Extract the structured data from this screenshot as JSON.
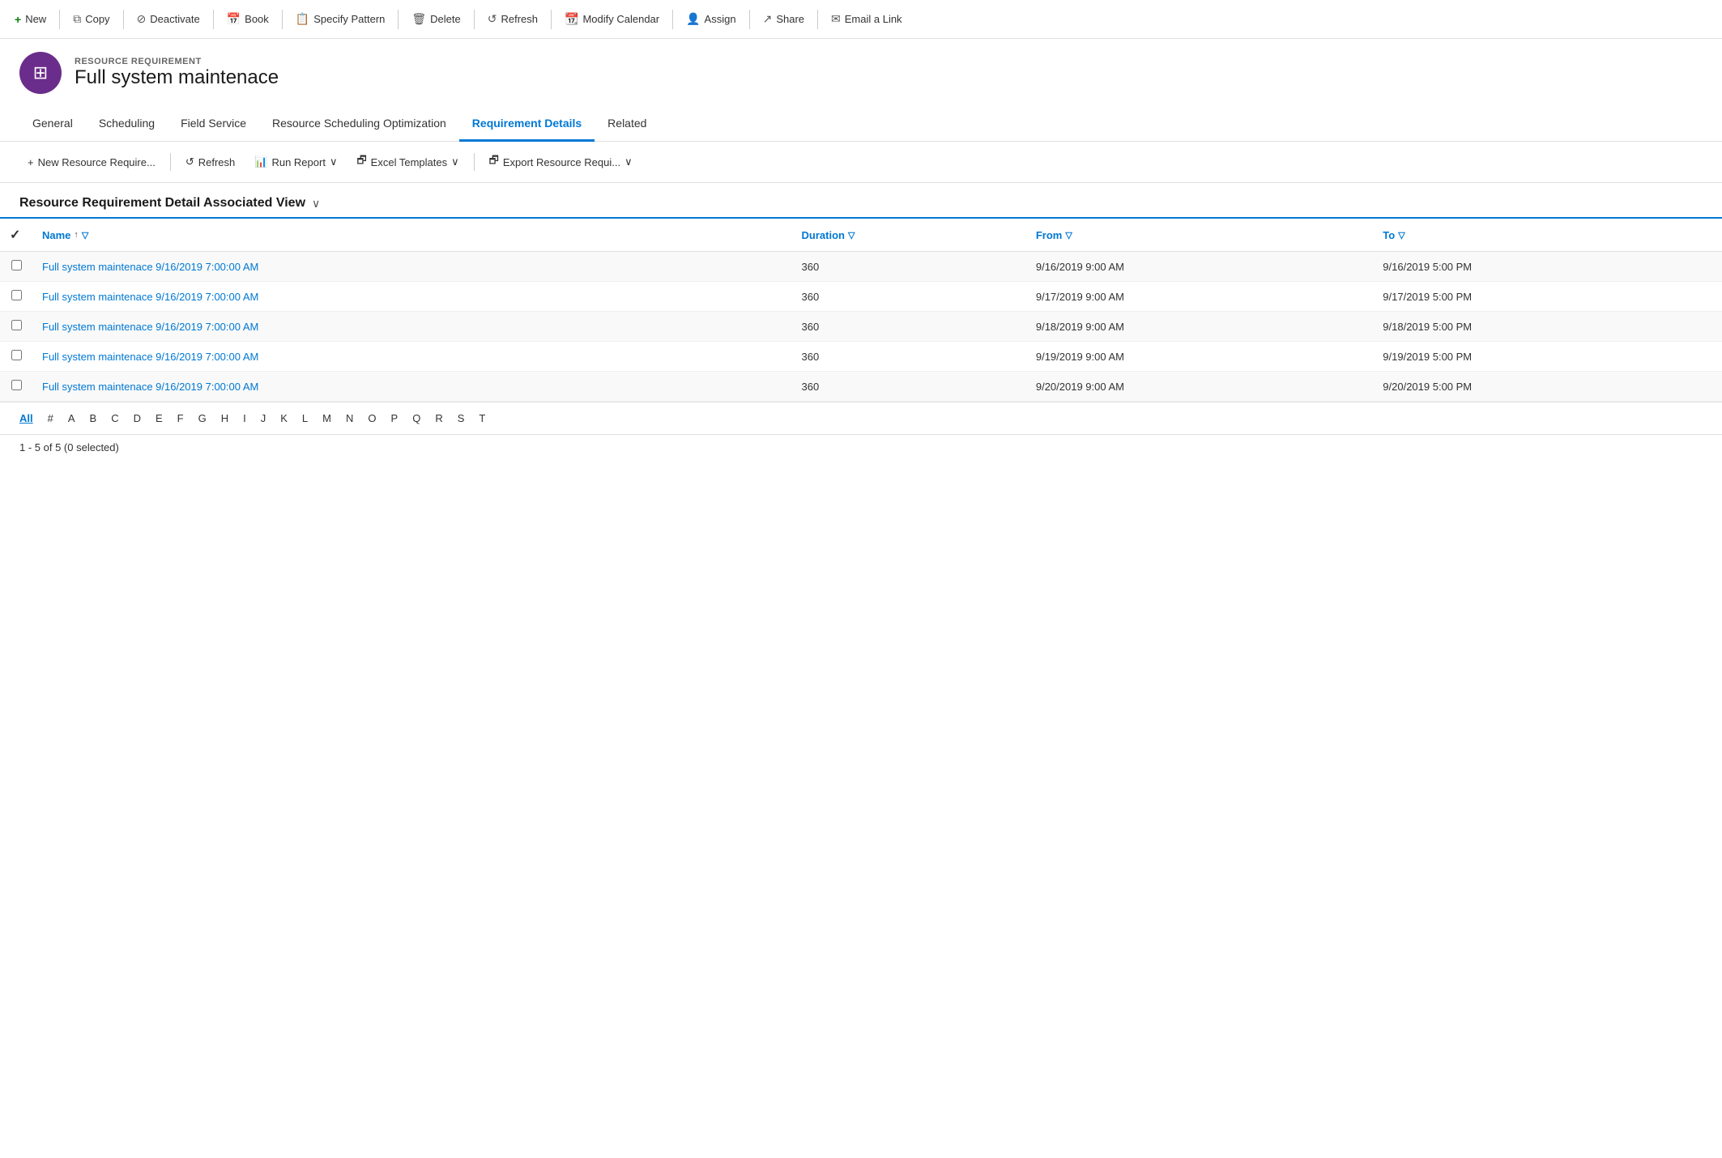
{
  "toolbar": {
    "buttons": [
      {
        "id": "new",
        "icon": "+",
        "label": "New",
        "icon_type": "plus"
      },
      {
        "id": "copy",
        "icon": "⧉",
        "label": "Copy"
      },
      {
        "id": "deactivate",
        "icon": "⊘",
        "label": "Deactivate"
      },
      {
        "id": "book",
        "icon": "📅",
        "label": "Book"
      },
      {
        "id": "specify-pattern",
        "icon": "📋",
        "label": "Specify Pattern"
      },
      {
        "id": "delete",
        "icon": "🗑",
        "label": "Delete"
      },
      {
        "id": "refresh",
        "icon": "↺",
        "label": "Refresh"
      },
      {
        "id": "modify-calendar",
        "icon": "📆",
        "label": "Modify Calendar"
      },
      {
        "id": "assign",
        "icon": "👤",
        "label": "Assign"
      },
      {
        "id": "share",
        "icon": "↗",
        "label": "Share"
      },
      {
        "id": "email-link",
        "icon": "✉",
        "label": "Email a Link"
      }
    ]
  },
  "header": {
    "subtitle": "RESOURCE REQUIREMENT",
    "title": "Full system maintenace",
    "avatar_icon": "⊞"
  },
  "nav": {
    "tabs": [
      {
        "id": "general",
        "label": "General"
      },
      {
        "id": "scheduling",
        "label": "Scheduling"
      },
      {
        "id": "field-service",
        "label": "Field Service"
      },
      {
        "id": "resource-scheduling",
        "label": "Resource Scheduling Optimization"
      },
      {
        "id": "requirement-details",
        "label": "Requirement Details",
        "active": true
      },
      {
        "id": "related",
        "label": "Related"
      }
    ]
  },
  "sub_toolbar": {
    "buttons": [
      {
        "id": "new-resource",
        "icon": "+",
        "label": "New Resource Require..."
      },
      {
        "id": "refresh",
        "icon": "↺",
        "label": "Refresh"
      },
      {
        "id": "run-report",
        "icon": "📊",
        "label": "Run Report",
        "has_dropdown": true
      },
      {
        "id": "excel-templates",
        "icon": "🗗",
        "label": "Excel Templates",
        "has_dropdown": true
      },
      {
        "id": "export-resource",
        "icon": "🗗",
        "label": "Export Resource Requi...",
        "has_dropdown": true
      }
    ]
  },
  "view": {
    "title": "Resource Requirement Detail Associated View",
    "has_dropdown": true
  },
  "table": {
    "columns": [
      {
        "id": "name",
        "label": "Name",
        "has_sort": true,
        "has_filter": true
      },
      {
        "id": "duration",
        "label": "Duration",
        "has_sort": false,
        "has_filter": true
      },
      {
        "id": "from",
        "label": "From",
        "has_sort": false,
        "has_filter": true
      },
      {
        "id": "to",
        "label": "To",
        "has_sort": false,
        "has_filter": true
      }
    ],
    "rows": [
      {
        "name": "Full system maintenace 9/16/2019 7:00:00 AM",
        "duration": "360",
        "from": "9/16/2019 9:00 AM",
        "to": "9/16/2019 5:00 PM"
      },
      {
        "name": "Full system maintenace 9/16/2019 7:00:00 AM",
        "duration": "360",
        "from": "9/17/2019 9:00 AM",
        "to": "9/17/2019 5:00 PM"
      },
      {
        "name": "Full system maintenace 9/16/2019 7:00:00 AM",
        "duration": "360",
        "from": "9/18/2019 9:00 AM",
        "to": "9/18/2019 5:00 PM"
      },
      {
        "name": "Full system maintenace 9/16/2019 7:00:00 AM",
        "duration": "360",
        "from": "9/19/2019 9:00 AM",
        "to": "9/19/2019 5:00 PM"
      },
      {
        "name": "Full system maintenace 9/16/2019 7:00:00 AM",
        "duration": "360",
        "from": "9/20/2019 9:00 AM",
        "to": "9/20/2019 5:00 PM"
      }
    ]
  },
  "pagination": {
    "letters": [
      "All",
      "#",
      "A",
      "B",
      "C",
      "D",
      "E",
      "F",
      "G",
      "H",
      "I",
      "J",
      "K",
      "L",
      "M",
      "N",
      "O",
      "P",
      "Q",
      "R",
      "S",
      "T"
    ],
    "active": "All"
  },
  "status": {
    "text": "1 - 5 of 5 (0 selected)"
  }
}
